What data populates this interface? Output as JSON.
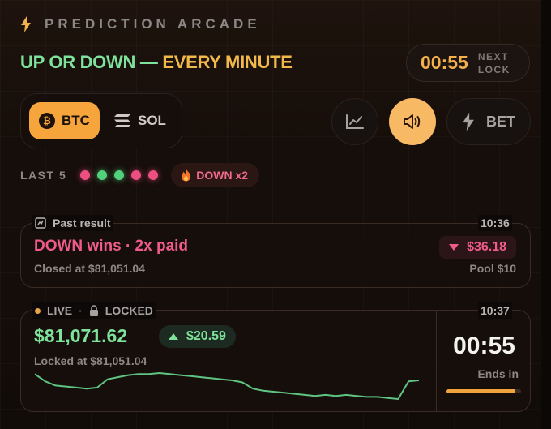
{
  "header": {
    "brand": "PREDICTION ARCADE",
    "headline_a": "UP OR DOWN —",
    "headline_b": "EVERY MINUTE",
    "timer": "00:55",
    "timer_label_1": "NEXT",
    "timer_label_2": "LOCK"
  },
  "assets": [
    {
      "label": "BTC",
      "selected": true
    },
    {
      "label": "SOL",
      "selected": false
    }
  ],
  "toolbar": {
    "chart_icon": "chart-line-icon",
    "sound_icon": "speaker-icon",
    "bet_label": "BET",
    "bet_icon": "bolt-icon"
  },
  "history": {
    "label": "LAST 5",
    "results": [
      "down",
      "up",
      "up",
      "down",
      "down"
    ],
    "streak_label": "DOWN x2",
    "streak_icon": "fire-icon"
  },
  "past_round": {
    "tag": "Past result",
    "time": "10:36",
    "title": "DOWN wins · 2x paid",
    "closed_at": "Closed at $81,051.04",
    "delta": "$36.18",
    "pool": "Pool $10"
  },
  "live_round": {
    "live_label": "LIVE",
    "locked_label": "LOCKED",
    "time": "10:37",
    "price": "$81,071.62",
    "delta": "$20.59",
    "locked_at": "Locked at $81,051.04",
    "countdown": "00:55",
    "ends_label": "Ends in",
    "progress": 0.92,
    "sparkline": [
      81082,
      81075,
      81071,
      81070,
      81069,
      81068,
      81069,
      81077,
      81079,
      81081,
      81082,
      81082,
      81083,
      81082,
      81081,
      81080,
      81079,
      81078,
      81077,
      81076,
      81074,
      81068,
      81066,
      81065,
      81064,
      81063,
      81062,
      81061,
      81062,
      81061,
      81062,
      81061,
      81060,
      81060,
      81059,
      81058,
      81075,
      81076
    ]
  },
  "colors": {
    "up": "#7ee29a",
    "down": "#ef5b8c",
    "accent": "#f6a43c"
  }
}
